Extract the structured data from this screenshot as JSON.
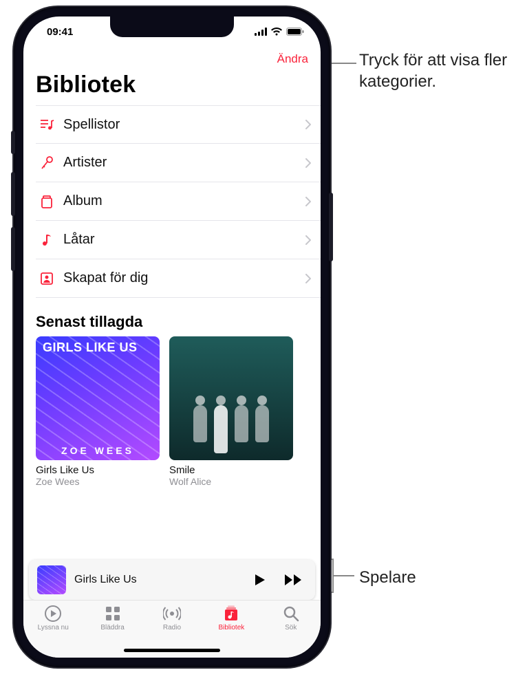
{
  "status": {
    "time": "09:41"
  },
  "nav": {
    "edit": "Ändra"
  },
  "title": "Bibliotek",
  "categories": [
    {
      "key": "playlists",
      "label": "Spellistor",
      "icon": "playlist-icon"
    },
    {
      "key": "artists",
      "label": "Artister",
      "icon": "mic-icon"
    },
    {
      "key": "albums",
      "label": "Album",
      "icon": "album-icon"
    },
    {
      "key": "songs",
      "label": "Låtar",
      "icon": "note-icon"
    },
    {
      "key": "madeforyou",
      "label": "Skapat för dig",
      "icon": "person-frame-icon"
    }
  ],
  "recent": {
    "heading": "Senast tillagda",
    "items": [
      {
        "title": "Girls Like Us",
        "artist": "Zoe Wees",
        "art_top": "GIRLS LIKE US",
        "art_bottom": "ZOE WEES"
      },
      {
        "title": "Smile",
        "artist": "Wolf Alice",
        "art_top": "",
        "art_bottom": ""
      }
    ]
  },
  "player": {
    "now_playing": "Girls Like Us"
  },
  "tabs": [
    {
      "key": "listen",
      "label": "Lyssna nu"
    },
    {
      "key": "browse",
      "label": "Bläddra"
    },
    {
      "key": "radio",
      "label": "Radio"
    },
    {
      "key": "library",
      "label": "Bibliotek"
    },
    {
      "key": "search",
      "label": "Sök"
    }
  ],
  "annotations": {
    "edit": "Tryck för att visa fler kategorier.",
    "player": "Spelare"
  },
  "colors": {
    "accent": "#fa233b"
  }
}
